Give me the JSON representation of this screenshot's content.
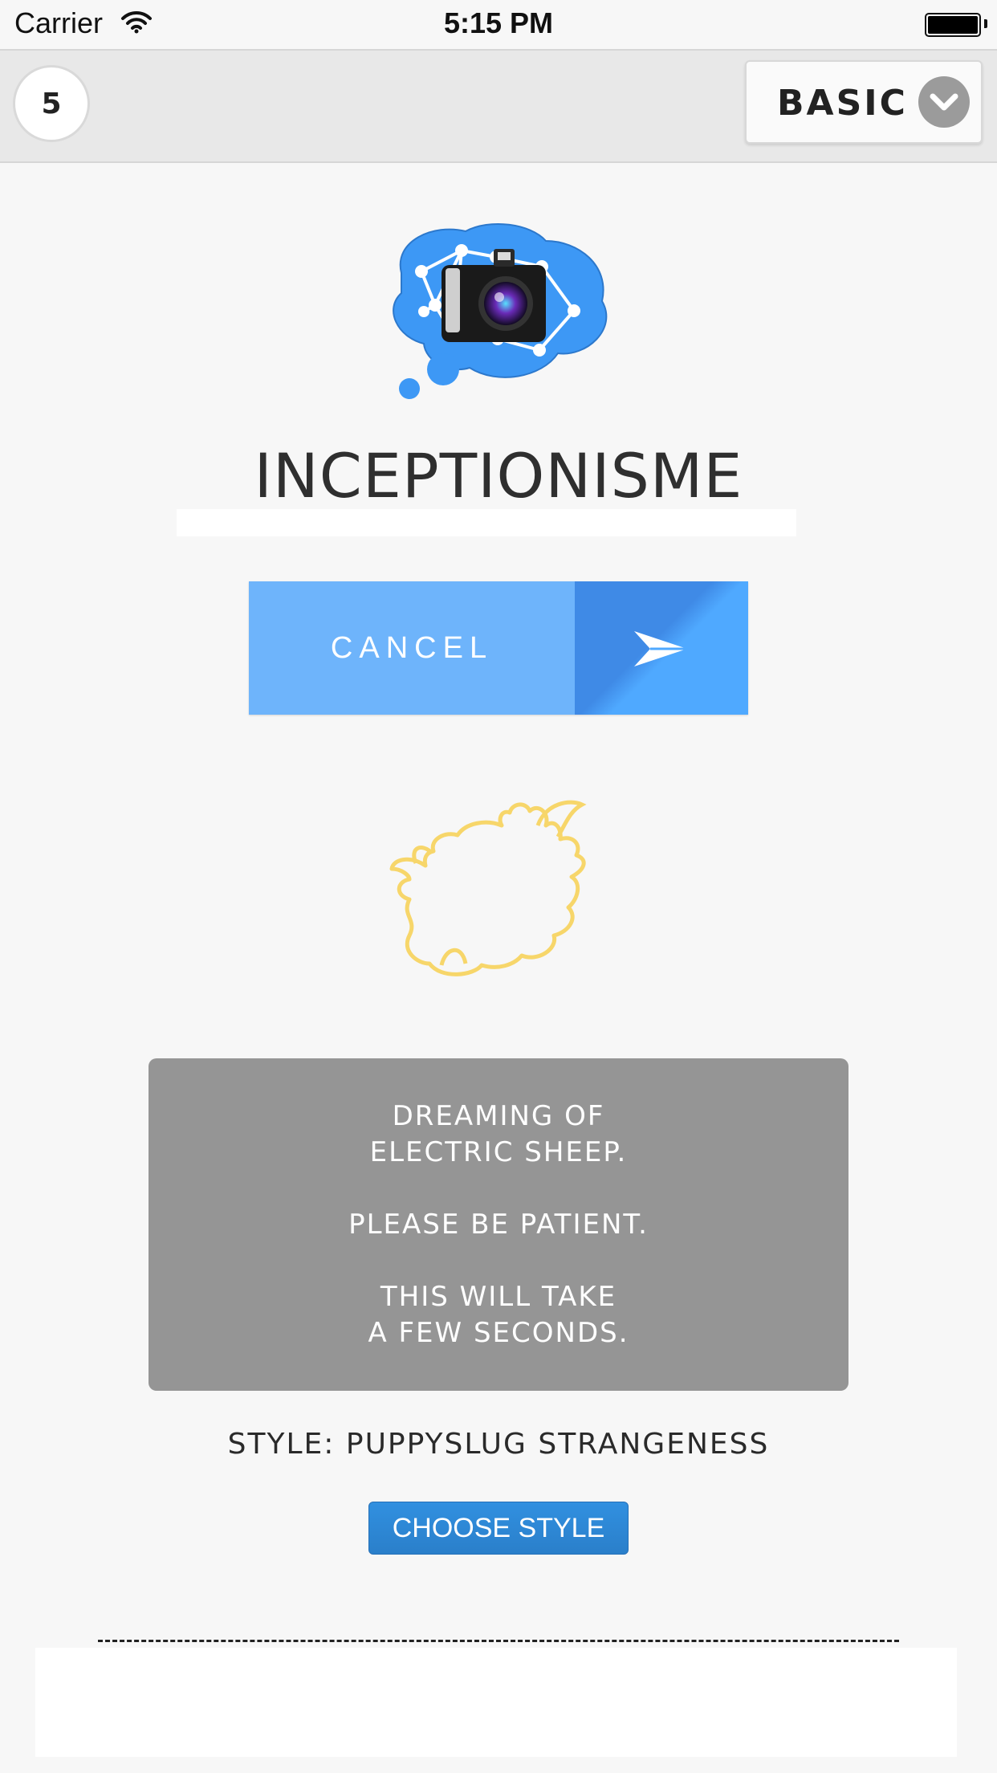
{
  "status_bar": {
    "carrier": "Carrier",
    "time": "5:15 PM"
  },
  "toolbar": {
    "count": "5",
    "mode_label": "BASIC"
  },
  "app": {
    "title": "INCEPTIONISME"
  },
  "action": {
    "cancel_label": "CANCEL"
  },
  "status_message": {
    "lines": [
      "DREAMING OF",
      "ELECTRIC SHEEP.",
      "",
      "PLEASE BE PATIENT.",
      "",
      "THIS WILL TAKE",
      "A FEW SECONDS."
    ]
  },
  "style": {
    "label": "STYLE: PUPPYSLUG STRANGENESS",
    "choose_button": "CHOOSE STYLE"
  },
  "colors": {
    "logo_blue": "#3d98f5",
    "button_blue": "#6eb4fb",
    "panel_gray": "#959595",
    "sheep_outline": "#f7d66a"
  }
}
